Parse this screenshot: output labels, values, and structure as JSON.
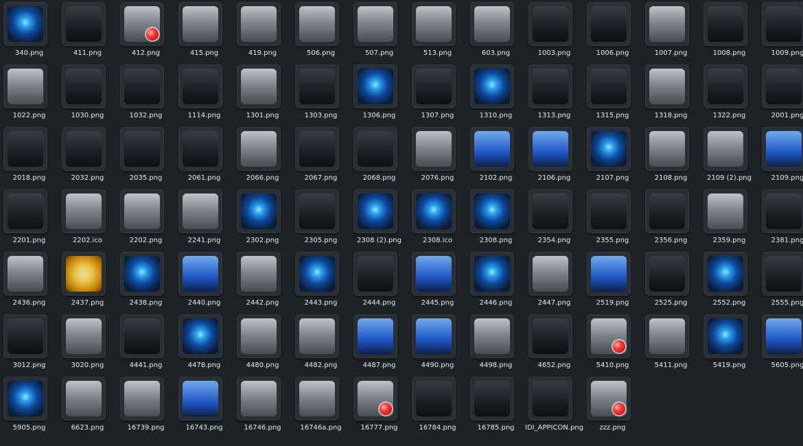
{
  "files": [
    {
      "name": "340.png",
      "style": "blue"
    },
    {
      "name": "411.png",
      "style": "dark"
    },
    {
      "name": "412.png",
      "style": "red"
    },
    {
      "name": "415.png",
      "style": ""
    },
    {
      "name": "419.png",
      "style": ""
    },
    {
      "name": "506.png",
      "style": ""
    },
    {
      "name": "507.png",
      "style": ""
    },
    {
      "name": "513.png",
      "style": ""
    },
    {
      "name": "603.png",
      "style": ""
    },
    {
      "name": "1003.png",
      "style": "dark"
    },
    {
      "name": "1006.png",
      "style": "dark"
    },
    {
      "name": "1007.png",
      "style": ""
    },
    {
      "name": "1008.png",
      "style": "dark"
    },
    {
      "name": "1009.png",
      "style": "dark"
    },
    {
      "name": "1022.png",
      "style": ""
    },
    {
      "name": "1030.png",
      "style": "dark"
    },
    {
      "name": "1032.png",
      "style": "dark"
    },
    {
      "name": "1114.png",
      "style": "dark"
    },
    {
      "name": "1301.png",
      "style": ""
    },
    {
      "name": "1303.png",
      "style": "dark"
    },
    {
      "name": "1306.png",
      "style": "blue"
    },
    {
      "name": "1307.png",
      "style": "dark"
    },
    {
      "name": "1310.png",
      "style": "blue"
    },
    {
      "name": "1313.png",
      "style": "dark"
    },
    {
      "name": "1315.png",
      "style": "dark"
    },
    {
      "name": "1318.png",
      "style": ""
    },
    {
      "name": "1322.png",
      "style": "dark"
    },
    {
      "name": "2001.png",
      "style": "dark"
    },
    {
      "name": "2018.png",
      "style": "dark"
    },
    {
      "name": "2032.png",
      "style": "dark"
    },
    {
      "name": "2035.png",
      "style": "dark"
    },
    {
      "name": "2061.png",
      "style": "dark"
    },
    {
      "name": "2066.png",
      "style": ""
    },
    {
      "name": "2067.png",
      "style": "dark"
    },
    {
      "name": "2068.png",
      "style": "dark"
    },
    {
      "name": "2076.png",
      "style": ""
    },
    {
      "name": "2102.png",
      "style": "mon"
    },
    {
      "name": "2106.png",
      "style": "mon"
    },
    {
      "name": "2107.png",
      "style": "blue"
    },
    {
      "name": "2108.png",
      "style": ""
    },
    {
      "name": "2109 (2).png",
      "style": ""
    },
    {
      "name": "2109.png",
      "style": "mon"
    },
    {
      "name": "2201.png",
      "style": "dark"
    },
    {
      "name": "2202.ico",
      "style": ""
    },
    {
      "name": "2202.png",
      "style": ""
    },
    {
      "name": "2241.png",
      "style": ""
    },
    {
      "name": "2302.png",
      "style": "blue"
    },
    {
      "name": "2305.png",
      "style": "dark"
    },
    {
      "name": "2308 (2).png",
      "style": "blue"
    },
    {
      "name": "2308.ico",
      "style": "blue"
    },
    {
      "name": "2308.png",
      "style": "blue"
    },
    {
      "name": "2354.png",
      "style": "dark"
    },
    {
      "name": "2355.png",
      "style": "dark"
    },
    {
      "name": "2356.png",
      "style": "dark"
    },
    {
      "name": "2359.png",
      "style": ""
    },
    {
      "name": "2381.png",
      "style": "dark"
    },
    {
      "name": "2436.png",
      "style": ""
    },
    {
      "name": "2437.png",
      "style": "sun"
    },
    {
      "name": "2438.png",
      "style": "blue"
    },
    {
      "name": "2440.png",
      "style": "mon"
    },
    {
      "name": "2442.png",
      "style": ""
    },
    {
      "name": "2443.png",
      "style": "blue"
    },
    {
      "name": "2444.png",
      "style": "dark"
    },
    {
      "name": "2445.png",
      "style": "mon"
    },
    {
      "name": "2446.png",
      "style": "blue"
    },
    {
      "name": "2447.png",
      "style": ""
    },
    {
      "name": "2519.png",
      "style": "mon"
    },
    {
      "name": "2525.png",
      "style": "dark"
    },
    {
      "name": "2552.png",
      "style": "blue"
    },
    {
      "name": "2555.png",
      "style": "dark"
    },
    {
      "name": "3012.png",
      "style": "dark"
    },
    {
      "name": "3020.png",
      "style": ""
    },
    {
      "name": "4441.png",
      "style": "dark"
    },
    {
      "name": "4478.png",
      "style": "blue"
    },
    {
      "name": "4480.png",
      "style": ""
    },
    {
      "name": "4482.png",
      "style": ""
    },
    {
      "name": "4487.png",
      "style": "mon"
    },
    {
      "name": "4490.png",
      "style": "mon"
    },
    {
      "name": "4498.png",
      "style": ""
    },
    {
      "name": "4652.png",
      "style": "dark"
    },
    {
      "name": "5410.png",
      "style": "red"
    },
    {
      "name": "5411.png",
      "style": ""
    },
    {
      "name": "5419.png",
      "style": "blue"
    },
    {
      "name": "5605.png",
      "style": "mon"
    },
    {
      "name": "5905.png",
      "style": "blue"
    },
    {
      "name": "6623.png",
      "style": ""
    },
    {
      "name": "16739.png",
      "style": ""
    },
    {
      "name": "16743.png",
      "style": "mon"
    },
    {
      "name": "16746.png",
      "style": ""
    },
    {
      "name": "16746a.png",
      "style": ""
    },
    {
      "name": "16777.png",
      "style": "red"
    },
    {
      "name": "16784.png",
      "style": "dark"
    },
    {
      "name": "16785.png",
      "style": "dark"
    },
    {
      "name": "IDI_APPICON.png",
      "style": "dark"
    },
    {
      "name": "zzz.png",
      "style": "red"
    }
  ]
}
